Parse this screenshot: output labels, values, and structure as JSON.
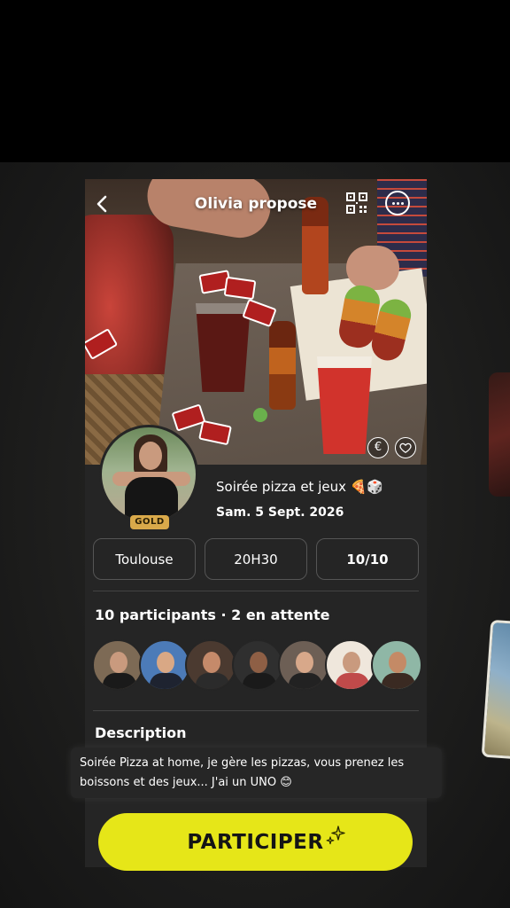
{
  "header": {
    "title": "Olivia propose"
  },
  "host": {
    "badge": "GOLD"
  },
  "event": {
    "name": "Soirée pizza et jeux 🍕🎲",
    "date": "Sam. 5 Sept. 2026",
    "city": "Toulouse",
    "time": "20H30",
    "capacity": "10/10"
  },
  "participants": {
    "title": "10 participants · 2 en attente",
    "avatars": [
      {
        "bg": "#7d6a55",
        "face": "#c99a7e",
        "body": "#1a1a1a"
      },
      {
        "bg": "#4c7bb8",
        "face": "#d9a885",
        "body": "#1e2330"
      },
      {
        "bg": "#4b3a30",
        "face": "#c58a6a",
        "body": "#2b2b2b"
      },
      {
        "bg": "#2f2f2f",
        "face": "#8e5f45",
        "body": "#1a1a1a"
      },
      {
        "bg": "#6d5f55",
        "face": "#d8a88a",
        "body": "#222222"
      },
      {
        "bg": "#efe7dc",
        "face": "#c99a7e",
        "body": "#c04a4a"
      },
      {
        "bg": "#8fb7a6",
        "face": "#c48a66",
        "body": "#3a2a22"
      }
    ]
  },
  "description": {
    "title": "Description",
    "text_line1": "Soirée Pizza at home, je gère les pizzas, vous prenez les",
    "text_line2": "boissons et des jeux... J'ai un UNO 😊"
  },
  "cta": {
    "label": "PARTICIPER"
  },
  "colors": {
    "accent": "#e6e618",
    "card": "#252525",
    "gold": "#d9a94a"
  }
}
